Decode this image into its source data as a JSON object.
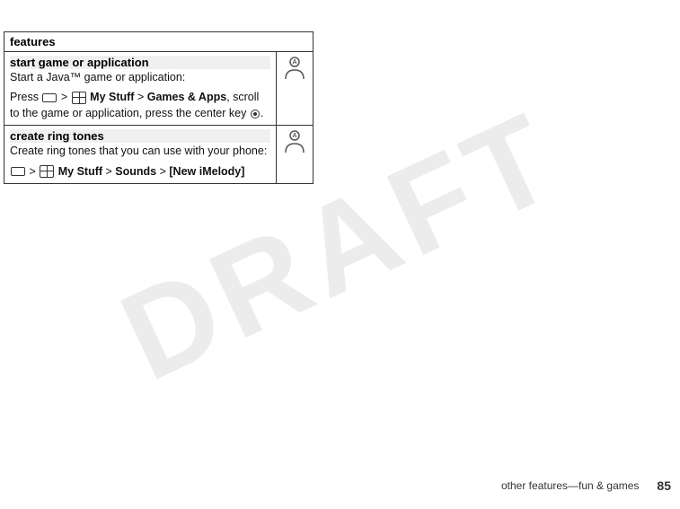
{
  "watermark": "DRAFT",
  "table": {
    "header": "features",
    "rows": [
      {
        "id": "start-game",
        "section_header": "start game or application",
        "content_lines": [
          "Start a Java™ game or application:",
          "Press [menu] > [mystuff] My Stuff > Games & Apps, scroll to the game or application, press the center key [dot]."
        ],
        "has_icon": true
      },
      {
        "id": "create-ring",
        "section_header": "create ring tones",
        "content_lines": [
          "Create ring tones that you can use with your phone:",
          "[menu] > [mystuff] My Stuff > Sounds > [New iMelody]"
        ],
        "has_icon": true
      }
    ]
  },
  "footer": {
    "label": "other features—fun & games",
    "page_number": "85"
  }
}
